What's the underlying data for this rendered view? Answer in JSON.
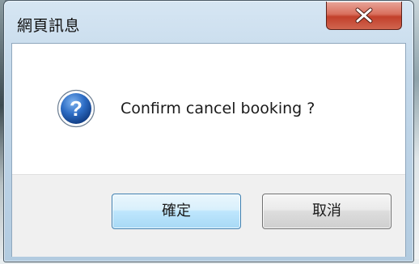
{
  "window": {
    "title": "網頁訊息",
    "close_icon": "close-icon"
  },
  "dialog": {
    "icon": "question-icon",
    "message": "Confirm cancel booking ?"
  },
  "buttons": {
    "ok_label": "確定",
    "cancel_label": "取消"
  },
  "colors": {
    "close_button": "#c2402b",
    "question_icon": "#1f5fb0"
  }
}
